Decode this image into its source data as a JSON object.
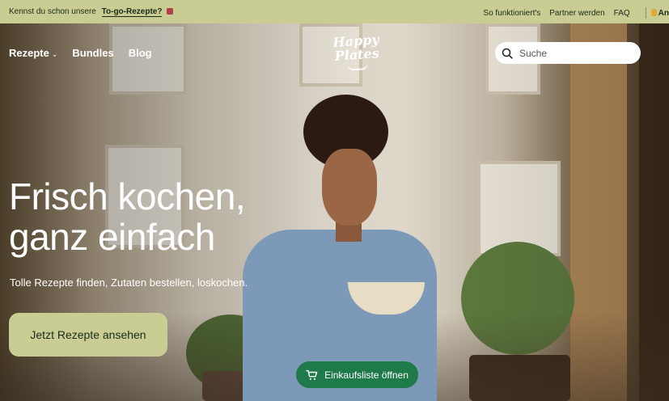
{
  "topbar": {
    "promo_text": "Kennst du schon unsere",
    "promo_link": "To-go-Rezepte?",
    "links": [
      "So funktioniert's",
      "Partner werden",
      "FAQ"
    ],
    "cut_item": "An"
  },
  "nav": {
    "items": [
      "Rezepte",
      "Bundles",
      "Blog"
    ],
    "logo_line1": "Happy",
    "logo_line2": "Plates",
    "search_placeholder": "Suche"
  },
  "hero": {
    "headline_line1": "Frisch kochen,",
    "headline_line2": "ganz einfach",
    "subline": "Tolle Rezepte finden, Zutaten bestellen, loskochen.",
    "cta_label": "Jetzt Rezepte ansehen",
    "shopping_list_label": "Einkaufsliste öffnen"
  },
  "colors": {
    "accent": "#c9cd94",
    "button_green": "#1f7a4a",
    "text_dark": "#1c2a18"
  }
}
